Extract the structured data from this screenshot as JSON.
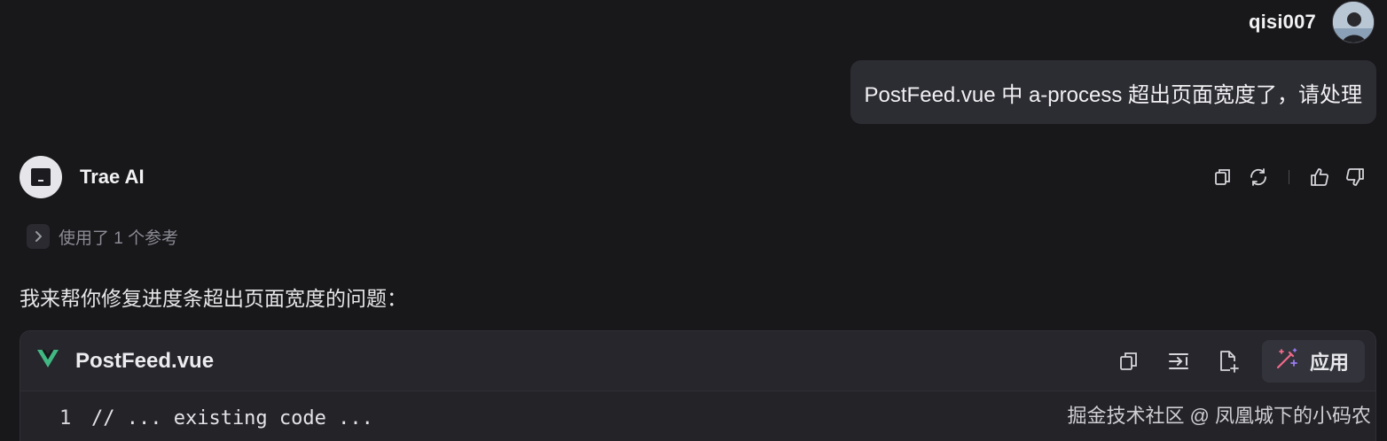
{
  "user": {
    "name": "qisi007",
    "message": "PostFeed.vue 中 a-process 超出页面宽度了，请处理"
  },
  "assistant": {
    "name": "Trae AI",
    "references_label": "使用了 1 个参考",
    "intro": "我来帮你修复进度条超出页面宽度的问题："
  },
  "code_block": {
    "file_name": "PostFeed.vue",
    "apply_label": "应用",
    "lines": [
      {
        "number": "1",
        "code": "// ... existing code ..."
      }
    ]
  },
  "watermark": "掘金技术社区 @ 凤凰城下的小码农",
  "icons": {
    "copy": "copy-icon",
    "regenerate": "refresh-icon",
    "like": "thumbs-up-icon",
    "dislike": "thumbs-down-icon",
    "insert": "insert-to-terminal-icon",
    "new_file": "add-file-icon",
    "apply": "magic-wand-icon",
    "vue": "vue-logo-icon"
  },
  "colors": {
    "background": "#18181b",
    "bubble": "#2c2c33",
    "code_bg": "#232328",
    "vue_green": "#41b883"
  }
}
